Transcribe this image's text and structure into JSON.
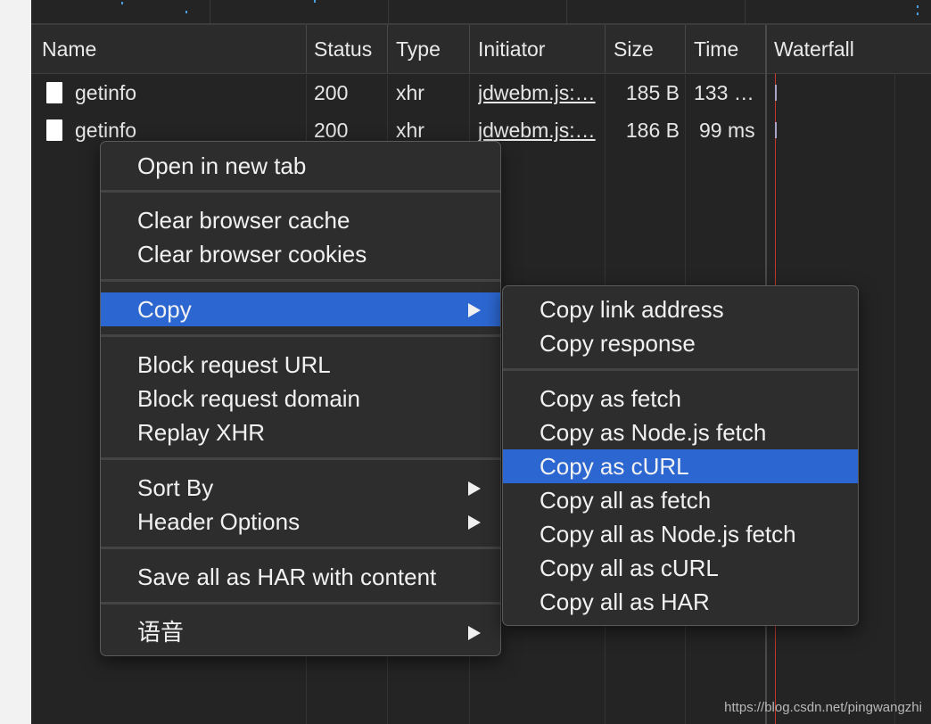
{
  "columns": [
    "Name",
    "Status",
    "Type",
    "Initiator",
    "Size",
    "Time",
    "Waterfall"
  ],
  "rows": [
    {
      "name": "getinfo",
      "status": "200",
      "type": "xhr",
      "initiator": "jdwebm.js:…",
      "size": "185 B",
      "time": "133 …"
    },
    {
      "name": "getinfo",
      "status": "200",
      "type": "xhr",
      "initiator": "jdwebm.js:…",
      "size": "186 B",
      "time": "99 ms"
    }
  ],
  "context_menu": {
    "open_new_tab": "Open in new tab",
    "clear_cache": "Clear browser cache",
    "clear_cookies": "Clear browser cookies",
    "copy": "Copy",
    "block_url": "Block request URL",
    "block_domain": "Block request domain",
    "replay_xhr": "Replay XHR",
    "sort_by": "Sort By",
    "header_options": "Header Options",
    "save_har": "Save all as HAR with content",
    "speech": "语音"
  },
  "copy_submenu": {
    "copy_link": "Copy link address",
    "copy_response": "Copy response",
    "copy_fetch": "Copy as fetch",
    "copy_node_fetch": "Copy as Node.js fetch",
    "copy_curl": "Copy as cURL",
    "copy_all_fetch": "Copy all as fetch",
    "copy_all_node_fetch": "Copy all as Node.js fetch",
    "copy_all_curl": "Copy all as cURL",
    "copy_all_har": "Copy all as HAR"
  },
  "watermark": "https://blog.csdn.net/pingwangzhi",
  "colors": {
    "highlight": "#2c67d1",
    "background": "#242424",
    "timeline_marker": "#c0392b"
  }
}
